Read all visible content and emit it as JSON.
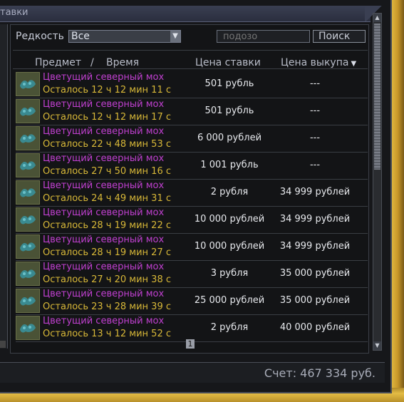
{
  "window": {
    "title_partial": "тавки"
  },
  "filters": {
    "rarity_label": "Редкость",
    "rarity_value": "Все",
    "search_placeholder": "подозо",
    "search_button": "Поиск"
  },
  "columns": {
    "item": "Предмет",
    "separator": "/",
    "time": "Время",
    "bid": "Цена ставки",
    "buyout": "Цена выкупа"
  },
  "rows": [
    {
      "name": "Цветущий северный мох",
      "time": "Осталось 12 ч 12 мин 11 с",
      "bid": "501 рубль",
      "buyout": "---"
    },
    {
      "name": "Цветущий северный мох",
      "time": "Осталось 12 ч 12 мин 17 с",
      "bid": "501 рубль",
      "buyout": "---"
    },
    {
      "name": "Цветущий северный мох",
      "time": "Осталось 22 ч 48 мин 53 с",
      "bid": "6 000 рублей",
      "buyout": "---"
    },
    {
      "name": "Цветущий северный мох",
      "time": "Осталось 27 ч 50 мин 16 с",
      "bid": "1 001 рубль",
      "buyout": "---"
    },
    {
      "name": "Цветущий северный мох",
      "time": "Осталось 24 ч 49 мин 31 с",
      "bid": "2 рубля",
      "buyout": "34 999 рублей"
    },
    {
      "name": "Цветущий северный мох",
      "time": "Осталось 28 ч 19 мин 22 с",
      "bid": "10 000 рублей",
      "buyout": "34 999 рублей"
    },
    {
      "name": "Цветущий северный мох",
      "time": "Осталось 28 ч 19 мин 27 с",
      "bid": "10 000 рублей",
      "buyout": "34 999 рублей"
    },
    {
      "name": "Цветущий северный мох",
      "time": "Осталось 27 ч 20 мин 38 с",
      "bid": "3 рубля",
      "buyout": "35 000 рублей"
    },
    {
      "name": "Цветущий северный мох",
      "time": "Осталось 23 ч 28 мин 39 с",
      "bid": "25 000 рублей",
      "buyout": "35 000 рублей"
    },
    {
      "name": "Цветущий северный мох",
      "time": "Осталось 13 ч 12 мин 52 с",
      "bid": "2 рубля",
      "buyout": "40 000 рублей"
    }
  ],
  "pagination": {
    "current_page": "1"
  },
  "footer": {
    "balance": "Счет: 467 334 руб."
  },
  "colors": {
    "item_name": "#c040d0",
    "time_left": "#d8b838",
    "frame_gold": "#e0b840"
  },
  "icons": {
    "item": "moss-icon",
    "sort": "sort-desc-icon",
    "dropdown": "chevron-down-icon"
  }
}
